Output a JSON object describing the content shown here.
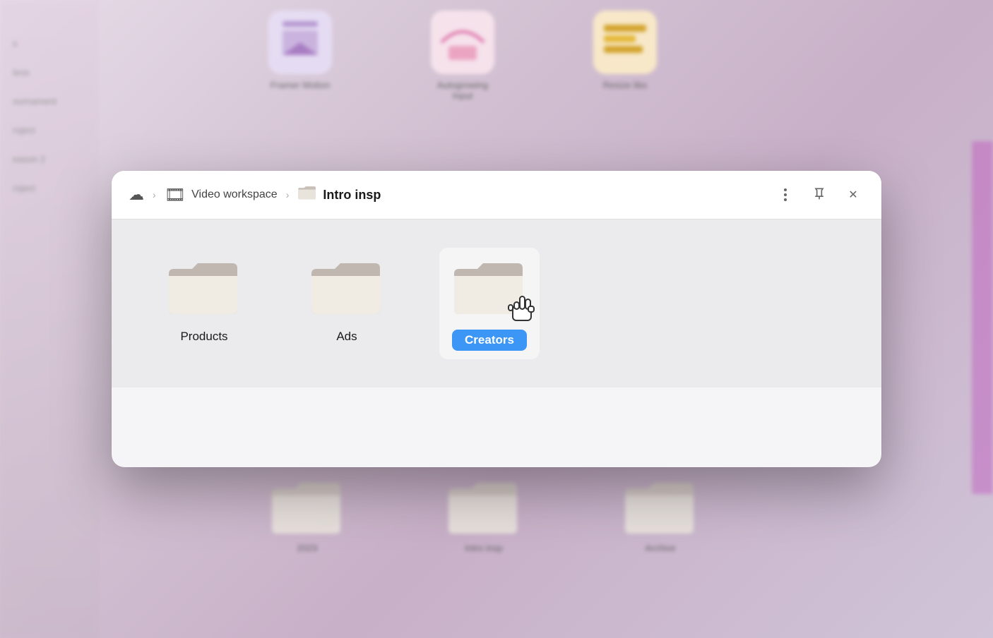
{
  "background": {
    "apps": [
      {
        "label": "Framer Motion",
        "color": "#e8e0f0",
        "accent": "#a080c0"
      },
      {
        "label": "Autogrowing Input",
        "color": "#fce8f0",
        "accent": "#e060a0"
      },
      {
        "label": "Resize libs",
        "color": "#fff0c8",
        "accent": "#d4a010"
      }
    ],
    "folders_bottom": [
      {
        "label": "2023"
      },
      {
        "label": "Intro insp"
      },
      {
        "label": "Archive"
      }
    ],
    "sidebar_items": [
      "s",
      "leos",
      "ournament",
      "roject",
      "eason 2",
      "roject"
    ]
  },
  "breadcrumb": {
    "cloud_icon": "☁",
    "workspace_icon": "🎞",
    "workspace_label": "Video workspace",
    "folder_icon": "📁",
    "current_label": "Intro insp"
  },
  "header_actions": {
    "more_label": "⋮",
    "pin_label": "⚲",
    "close_label": "✕"
  },
  "folders": [
    {
      "id": "products",
      "label": "Products",
      "selected": false
    },
    {
      "id": "ads",
      "label": "Ads",
      "selected": false
    },
    {
      "id": "creators",
      "label": "Creators",
      "selected": true
    }
  ]
}
